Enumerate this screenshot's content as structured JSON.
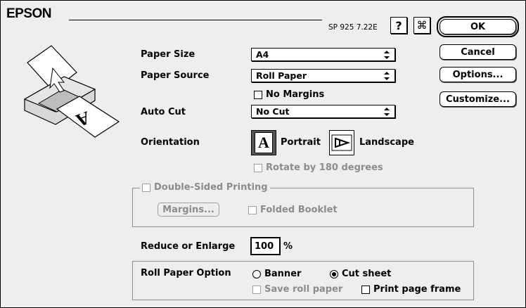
{
  "header": {
    "brand": "EPSON",
    "version": "SP 925 7.22E",
    "help_label": "?",
    "info_label": "⌘"
  },
  "buttons": {
    "ok": "OK",
    "cancel": "Cancel",
    "options": "Options...",
    "customize": "Customize..."
  },
  "settings": {
    "paper_size": {
      "label": "Paper Size",
      "value": "A4"
    },
    "paper_source": {
      "label": "Paper Source",
      "value": "Roll Paper"
    },
    "no_margins": {
      "label": "No Margins",
      "checked": false
    },
    "auto_cut": {
      "label": "Auto Cut",
      "value": "No Cut"
    },
    "orientation": {
      "label": "Orientation",
      "portrait": "Portrait",
      "landscape": "Landscape",
      "selected": "Portrait",
      "portrait_glyph": "A"
    },
    "rotate": {
      "label": "Rotate by 180 degrees",
      "checked": false,
      "enabled": false
    },
    "double_sided": {
      "label": "Double-Sided Printing",
      "checked": false,
      "enabled": false,
      "margins_button": "Margins...",
      "folded_booklet": "Folded Booklet"
    },
    "reduce": {
      "label": "Reduce or Enlarge",
      "value": "100",
      "unit": "%"
    },
    "roll_paper_option": {
      "label": "Roll Paper Option",
      "banner": "Banner",
      "cut_sheet": "Cut sheet",
      "selected": "Cut sheet",
      "save_roll_paper": "Save roll paper",
      "print_page_frame": "Print page frame"
    }
  },
  "preview": {
    "glyph": "A"
  }
}
